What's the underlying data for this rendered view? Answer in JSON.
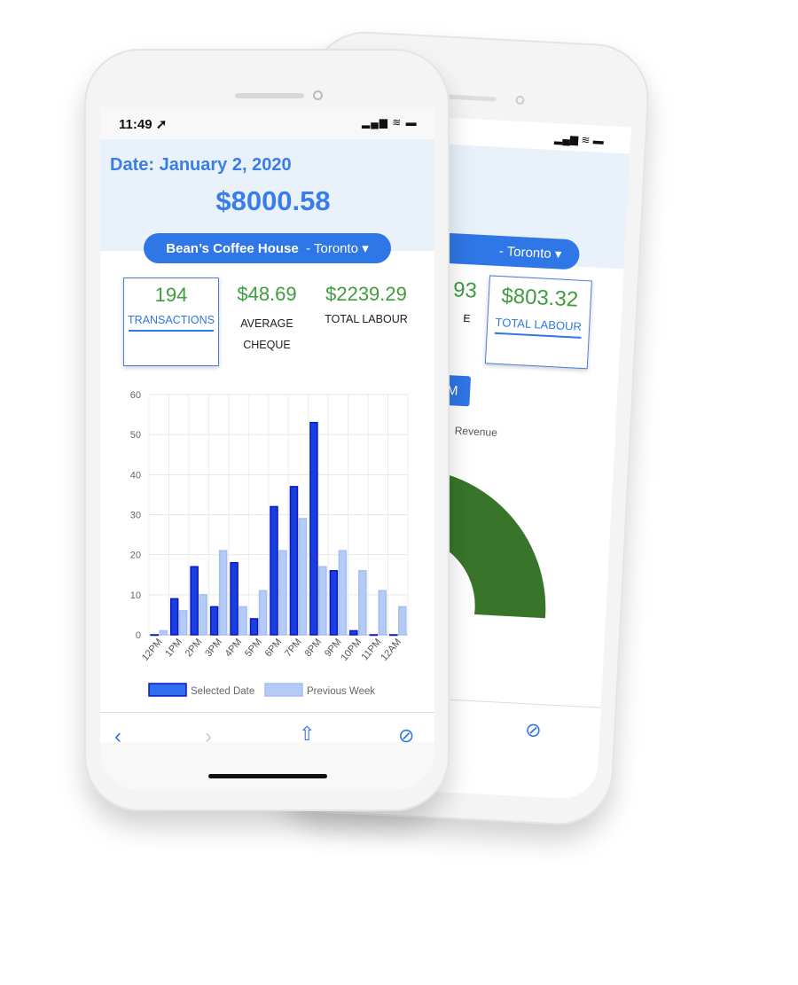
{
  "back_phone": {
    "location_label": "- Toronto",
    "partial_stat": "93",
    "partial_label": "E",
    "total_labour_value": "$803.32",
    "total_labour_label": "TOTAL LABOUR",
    "button_partial": "M",
    "legend_partial": "Revenue",
    "donut_color": "#38752a"
  },
  "front_phone": {
    "status_bar": {
      "time": "11:49"
    },
    "header": {
      "date": "Date: January 2, 2020",
      "total": "$8000.58"
    },
    "store_selector": {
      "store": "Bean’s Coffee House",
      "location": "- Toronto"
    },
    "stats": [
      {
        "value": "194",
        "label": "TRANSACTIONS",
        "selected": true
      },
      {
        "value": "$48.69",
        "label": "AVERAGE CHEQUE",
        "selected": false
      },
      {
        "value": "$2239.29",
        "label": "TOTAL LABOUR",
        "selected": false
      }
    ],
    "toolbar": {
      "icons": [
        "back-icon",
        "forward-icon",
        "share-icon",
        "compass-icon"
      ]
    }
  },
  "colors": {
    "accent": "#2f76e6",
    "stat_value": "#3f9c3f",
    "header_bg": "#e9f2fb"
  },
  "chart_data": {
    "type": "bar",
    "categories": [
      "12PM",
      "1PM",
      "2PM",
      "3PM",
      "4PM",
      "5PM",
      "6PM",
      "7PM",
      "8PM",
      "9PM",
      "10PM",
      "11PM",
      "12AM"
    ],
    "series": [
      {
        "name": "Selected Date",
        "color": "#1a3fe0",
        "values": [
          0,
          9,
          17,
          7,
          18,
          4,
          32,
          37,
          53,
          16,
          1,
          0,
          0
        ]
      },
      {
        "name": "Previous Week",
        "color": "#b3cbf5",
        "values": [
          1,
          6,
          10,
          21,
          7,
          11,
          21,
          29,
          17,
          21,
          16,
          11,
          7
        ]
      }
    ],
    "yticks": [
      0,
      10,
      20,
      30,
      40,
      50,
      60
    ],
    "ylim": [
      0,
      60
    ],
    "grid": true,
    "legend_position": "bottom"
  }
}
